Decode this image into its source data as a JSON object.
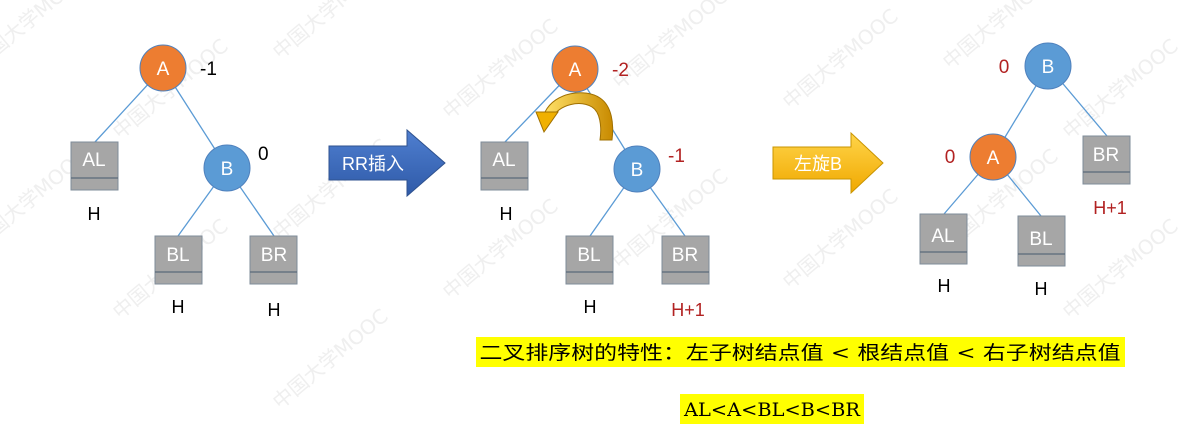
{
  "watermark": "中国大学MOOC",
  "panel_before": {
    "node_a": {
      "label": "A",
      "bf": "-1"
    },
    "node_b": {
      "label": "B",
      "bf": "0"
    },
    "box_al": {
      "label": "AL",
      "height": "H"
    },
    "box_bl": {
      "label": "BL",
      "height": "H"
    },
    "box_br": {
      "label": "BR",
      "height": "H"
    }
  },
  "arrow_insert": {
    "label": "RR插入"
  },
  "panel_after_insert": {
    "node_a": {
      "label": "A",
      "bf": "-2"
    },
    "node_b": {
      "label": "B",
      "bf": "-1"
    },
    "box_al": {
      "label": "AL",
      "height": "H"
    },
    "box_bl": {
      "label": "BL",
      "height": "H"
    },
    "box_br": {
      "label": "BR",
      "height": "H+1"
    }
  },
  "arrow_rotate": {
    "label": "左旋B"
  },
  "panel_after_rotate": {
    "node_b": {
      "label": "B",
      "bf": "0"
    },
    "node_a": {
      "label": "A",
      "bf": "0"
    },
    "box_al": {
      "label": "AL",
      "height": "H"
    },
    "box_bl": {
      "label": "BL",
      "height": "H"
    },
    "box_br": {
      "label": "BR",
      "height": "H+1"
    }
  },
  "notes": {
    "property": "二叉排序树的特性：左子树结点值 < 根结点值 < 右子树结点值",
    "ordering": "AL<A<BL<B<BR"
  },
  "colors": {
    "node_a": "#ed7d31",
    "node_b": "#5b9bd5",
    "box": "#a6a6a6",
    "edge": "#5b9bd5",
    "insert_arrow": "#4472c4",
    "rotate_arrow": "#ffc000",
    "highlight": "#ffff00",
    "red_text": "#b22222"
  }
}
